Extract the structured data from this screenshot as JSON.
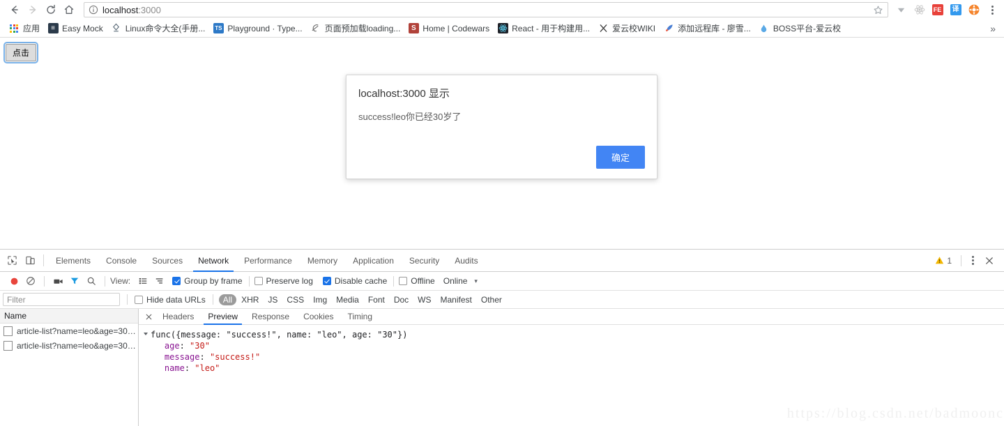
{
  "browser": {
    "nav": {
      "back": "back-arrow",
      "forward": "forward-arrow",
      "reload": "reload",
      "home": "home"
    },
    "omnibox": {
      "host": "localhost",
      "port": ":3000",
      "full_url": "localhost:3000",
      "info_icon": "info-circle-icon",
      "star_icon": "star-icon"
    },
    "extensions": [
      {
        "name": "downloads-arrow-icon",
        "glyph": "▼",
        "color": "#9aa0a6",
        "bg": "transparent",
        "text": ""
      },
      {
        "name": "react-devtools-icon",
        "glyph": "",
        "color": "#b8b8b8",
        "bg": "transparent",
        "text": ""
      },
      {
        "name": "fe-helper-icon",
        "glyph": "",
        "color": "#ffffff",
        "bg": "#e8413a",
        "text": "FE"
      },
      {
        "name": "translate-icon",
        "glyph": "",
        "color": "#ffffff",
        "bg": "#3399ee",
        "text": "译"
      },
      {
        "name": "orange-circle-icon",
        "glyph": "",
        "color": "#ffffff",
        "bg": "#f5832a",
        "text": ""
      }
    ],
    "menu_icon": "chrome-menu-icon"
  },
  "bookmarks": {
    "items": [
      {
        "label": "应用",
        "icon": "apps-grid-icon",
        "icon_type": "apps"
      },
      {
        "label": "Easy Mock",
        "icon": "easy-mock-icon",
        "icon_type": "sq",
        "bg": "#2b3a4a",
        "fg": "#ffffff",
        "text": "≣"
      },
      {
        "label": "Linux命令大全(手册...",
        "icon": "linux-manual-icon",
        "icon_type": "glyph",
        "fg": "#5b6b78",
        "text": "♁"
      },
      {
        "label": "Playground · Type...",
        "icon": "typescript-icon",
        "icon_type": "sq",
        "bg": "#2d79c7",
        "fg": "#ffffff",
        "text": "TS"
      },
      {
        "label": "页面预加载loading...",
        "icon": "page-preload-icon",
        "icon_type": "glyph",
        "fg": "#6b6b6b",
        "text": "✇"
      },
      {
        "label": "Home | Codewars",
        "icon": "codewars-icon",
        "icon_type": "sq",
        "bg": "#b1423a",
        "fg": "#ffffff",
        "text": "Ѕ"
      },
      {
        "label": "React - 用于构建用...",
        "icon": "react-icon",
        "icon_type": "sq",
        "bg": "#20232a",
        "fg": "#61dafb",
        "text": "⚛"
      },
      {
        "label": "爱云校WIKI",
        "icon": "aiyunxiao-wiki-icon",
        "icon_type": "glyph",
        "fg": "#3b3b3b",
        "text": "✂"
      },
      {
        "label": "添加远程库 - 廖雪...",
        "icon": "rocket-icon",
        "icon_type": "glyph",
        "fg": "#4a7fd4",
        "text": "🚀"
      },
      {
        "label": "BOSS平台-爱云校",
        "icon": "boss-platform-icon",
        "icon_type": "glyph",
        "fg": "#5aa9e6",
        "text": "▲"
      }
    ],
    "overflow_label": "»"
  },
  "page": {
    "button_label": "点击"
  },
  "dialog": {
    "title": "localhost:3000 显示",
    "message": "success!leo你已经30岁了",
    "ok_label": "确定",
    "ok_color": "#4285f4"
  },
  "devtools": {
    "tools": [
      {
        "name": "inspect-element-icon"
      },
      {
        "name": "device-toolbar-icon"
      }
    ],
    "tabs": [
      {
        "label": "Elements",
        "active": false
      },
      {
        "label": "Console",
        "active": false
      },
      {
        "label": "Sources",
        "active": false
      },
      {
        "label": "Network",
        "active": true
      },
      {
        "label": "Performance",
        "active": false
      },
      {
        "label": "Memory",
        "active": false
      },
      {
        "label": "Application",
        "active": false
      },
      {
        "label": "Security",
        "active": false
      },
      {
        "label": "Audits",
        "active": false
      }
    ],
    "warning_count": "1",
    "warning_icon": "warning-triangle-icon",
    "more_icon": "more-vertical-icon",
    "close_icon": "close-icon",
    "network_toolbar": {
      "record_icon": "record-circle-icon",
      "clear_icon": "clear-no-entry-icon",
      "capture_screenshots_icon": "camera-icon",
      "filter_icon": "funnel-icon",
      "search_icon": "search-icon",
      "view_label": "View:",
      "view_list_icon": "list-view-icon",
      "view_waterfall_icon": "waterfall-view-icon",
      "group_by_frame": {
        "label": "Group by frame",
        "checked": true
      },
      "preserve_log": {
        "label": "Preserve log",
        "checked": false
      },
      "disable_cache": {
        "label": "Disable cache",
        "checked": true
      },
      "offline": {
        "label": "Offline",
        "checked": false
      },
      "throttling": "Online",
      "throttling_caret": "▾"
    },
    "filter_bar": {
      "filter_placeholder": "Filter",
      "filter_value": "",
      "hide_data_urls": {
        "label": "Hide data URLs",
        "checked": false
      },
      "types": [
        {
          "label": "All",
          "active": true
        },
        {
          "label": "XHR",
          "active": false
        },
        {
          "label": "JS",
          "active": false
        },
        {
          "label": "CSS",
          "active": false
        },
        {
          "label": "Img",
          "active": false
        },
        {
          "label": "Media",
          "active": false
        },
        {
          "label": "Font",
          "active": false
        },
        {
          "label": "Doc",
          "active": false
        },
        {
          "label": "WS",
          "active": false
        },
        {
          "label": "Manifest",
          "active": false
        },
        {
          "label": "Other",
          "active": false
        }
      ]
    },
    "requests": {
      "column_header": "Name",
      "rows": [
        {
          "name": "article-list?name=leo&age=30…"
        },
        {
          "name": "article-list?name=leo&age=30…"
        }
      ]
    },
    "detail": {
      "close_icon": "close-icon",
      "tabs": [
        {
          "label": "Headers",
          "active": false
        },
        {
          "label": "Preview",
          "active": true
        },
        {
          "label": "Response",
          "active": false
        },
        {
          "label": "Cookies",
          "active": false
        },
        {
          "label": "Timing",
          "active": false
        }
      ],
      "preview": {
        "root": "func({message: \"success!\", name: \"leo\", age: \"30\"})",
        "entries": [
          {
            "key": "age",
            "value": "\"30\""
          },
          {
            "key": "message",
            "value": "\"success!\""
          },
          {
            "key": "name",
            "value": "\"leo\""
          }
        ],
        "key_color": "#881391",
        "string_color": "#c41a16"
      }
    }
  },
  "watermark": "https://blog.csdn.net/badmoonc"
}
